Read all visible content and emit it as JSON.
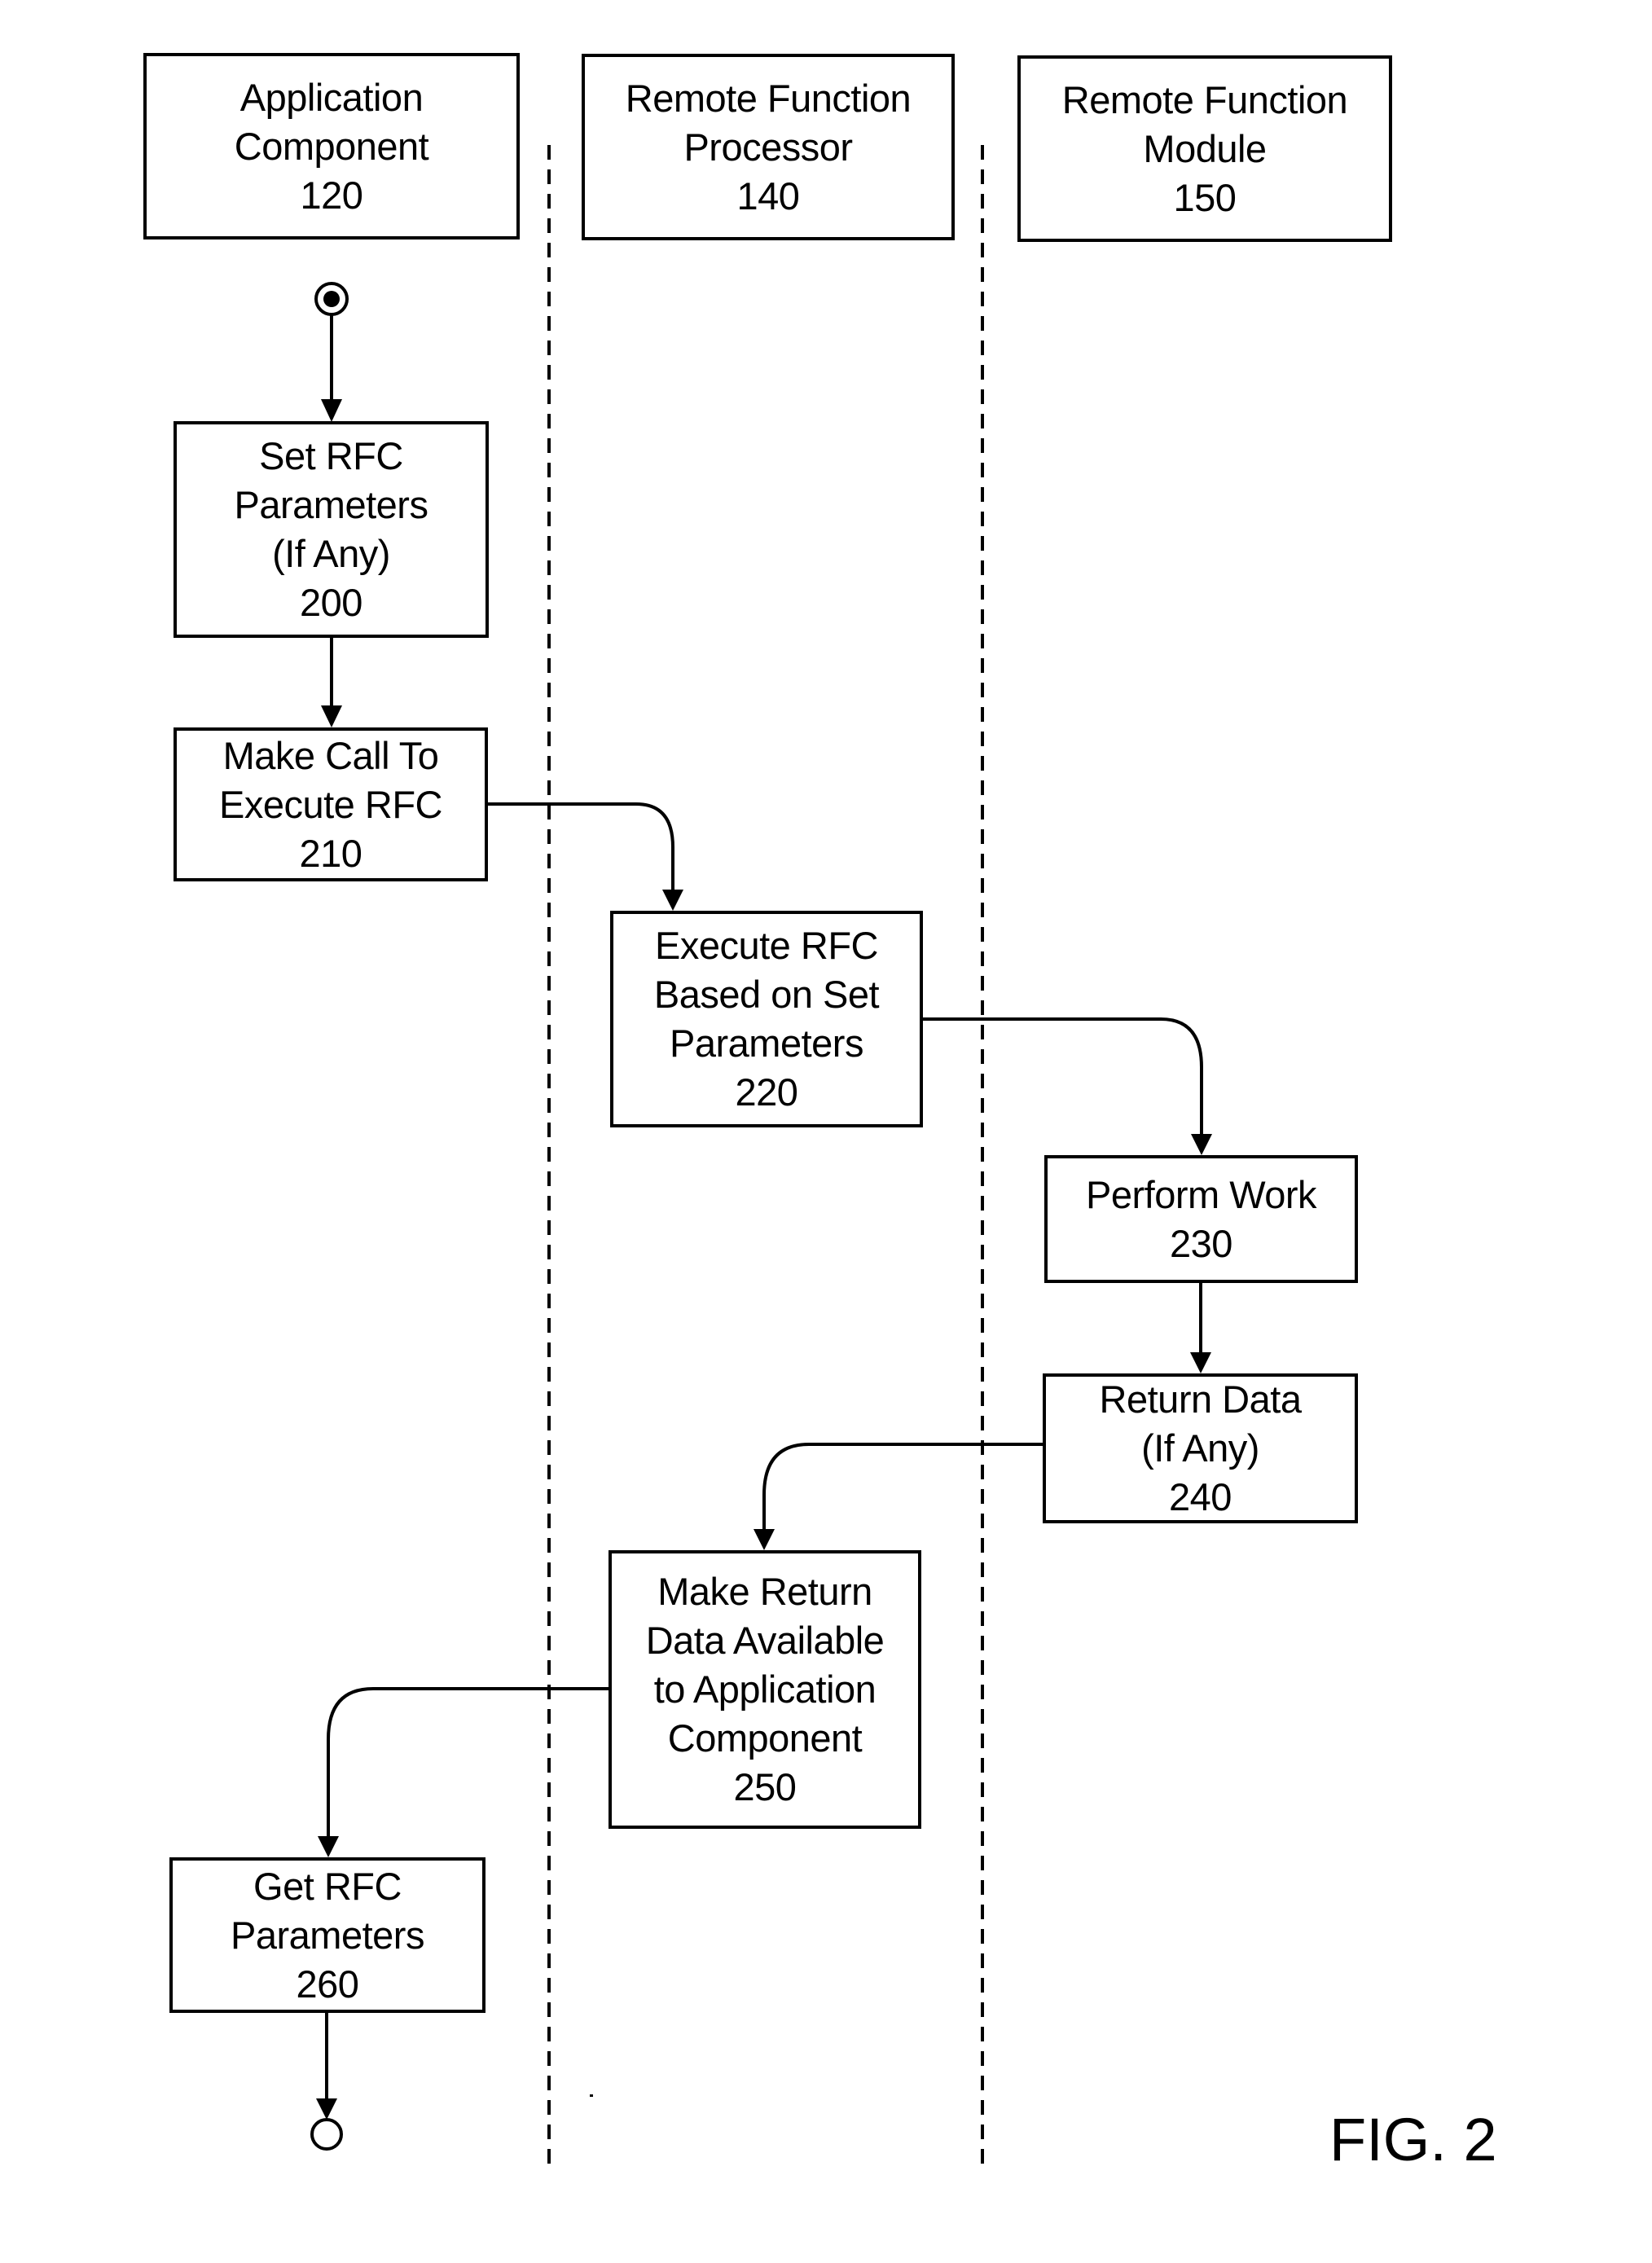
{
  "figure": {
    "label": "FIG. 2",
    "colors": {
      "ink": "#000000",
      "background": "#ffffff"
    }
  },
  "lanes": [
    {
      "id": "application-component",
      "lines": [
        "Application",
        "Component",
        "120"
      ]
    },
    {
      "id": "remote-function-processor",
      "lines": [
        "Remote Function",
        "Processor",
        "140"
      ]
    },
    {
      "id": "remote-function-module",
      "lines": [
        "Remote Function",
        "Module",
        "150"
      ]
    }
  ],
  "nodes": {
    "start": {
      "type": "initial-node-icon"
    },
    "end": {
      "type": "final-node-icon"
    }
  },
  "steps": [
    {
      "id": "200",
      "lane": "application-component",
      "lines": [
        "Set RFC",
        "Parameters",
        "(If Any)",
        "200"
      ]
    },
    {
      "id": "210",
      "lane": "application-component",
      "lines": [
        "Make Call To",
        "Execute RFC",
        "210"
      ]
    },
    {
      "id": "220",
      "lane": "remote-function-processor",
      "lines": [
        "Execute RFC",
        "Based on Set",
        "Parameters",
        "220"
      ]
    },
    {
      "id": "230",
      "lane": "remote-function-module",
      "lines": [
        "Perform Work",
        "230"
      ]
    },
    {
      "id": "240",
      "lane": "remote-function-module",
      "lines": [
        "Return Data",
        "(If Any)",
        "240"
      ]
    },
    {
      "id": "250",
      "lane": "remote-function-processor",
      "lines": [
        "Make Return",
        "Data Available",
        "to Application",
        "Component",
        "250"
      ]
    },
    {
      "id": "260",
      "lane": "application-component",
      "lines": [
        "Get RFC",
        "Parameters",
        "260"
      ]
    }
  ],
  "edges": [
    {
      "from": "start",
      "to": "200"
    },
    {
      "from": "200",
      "to": "210"
    },
    {
      "from": "210",
      "to": "220"
    },
    {
      "from": "220",
      "to": "230"
    },
    {
      "from": "230",
      "to": "240"
    },
    {
      "from": "240",
      "to": "250"
    },
    {
      "from": "250",
      "to": "260"
    },
    {
      "from": "260",
      "to": "end"
    }
  ]
}
